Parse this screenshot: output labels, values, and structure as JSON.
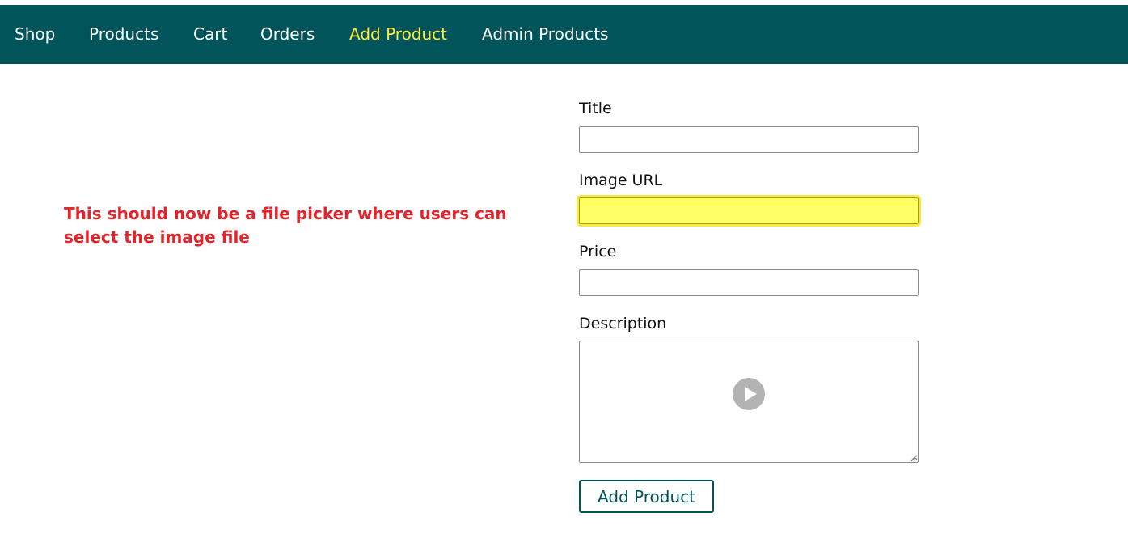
{
  "nav": {
    "items": [
      {
        "label": "Shop",
        "active": false
      },
      {
        "label": "Products",
        "active": false
      },
      {
        "label": "Cart",
        "active": false
      },
      {
        "label": "Orders",
        "active": false
      },
      {
        "label": "Add Product",
        "active": true
      },
      {
        "label": "Admin Products",
        "active": false
      }
    ],
    "bg_color": "#00545a",
    "text_color": "#ffffff",
    "active_color": "#ffeb3b"
  },
  "annotation": {
    "text": "This should now be a file picker where users can select the image file",
    "color": "#e3242b"
  },
  "form": {
    "title_label": "Title",
    "title_value": "",
    "image_url_label": "Image URL",
    "image_url_value": "",
    "image_url_highlight_color": "#ffff66",
    "price_label": "Price",
    "price_value": "",
    "description_label": "Description",
    "description_value": "",
    "description_overlay_icon": "play-icon",
    "submit_label": "Add Product"
  }
}
